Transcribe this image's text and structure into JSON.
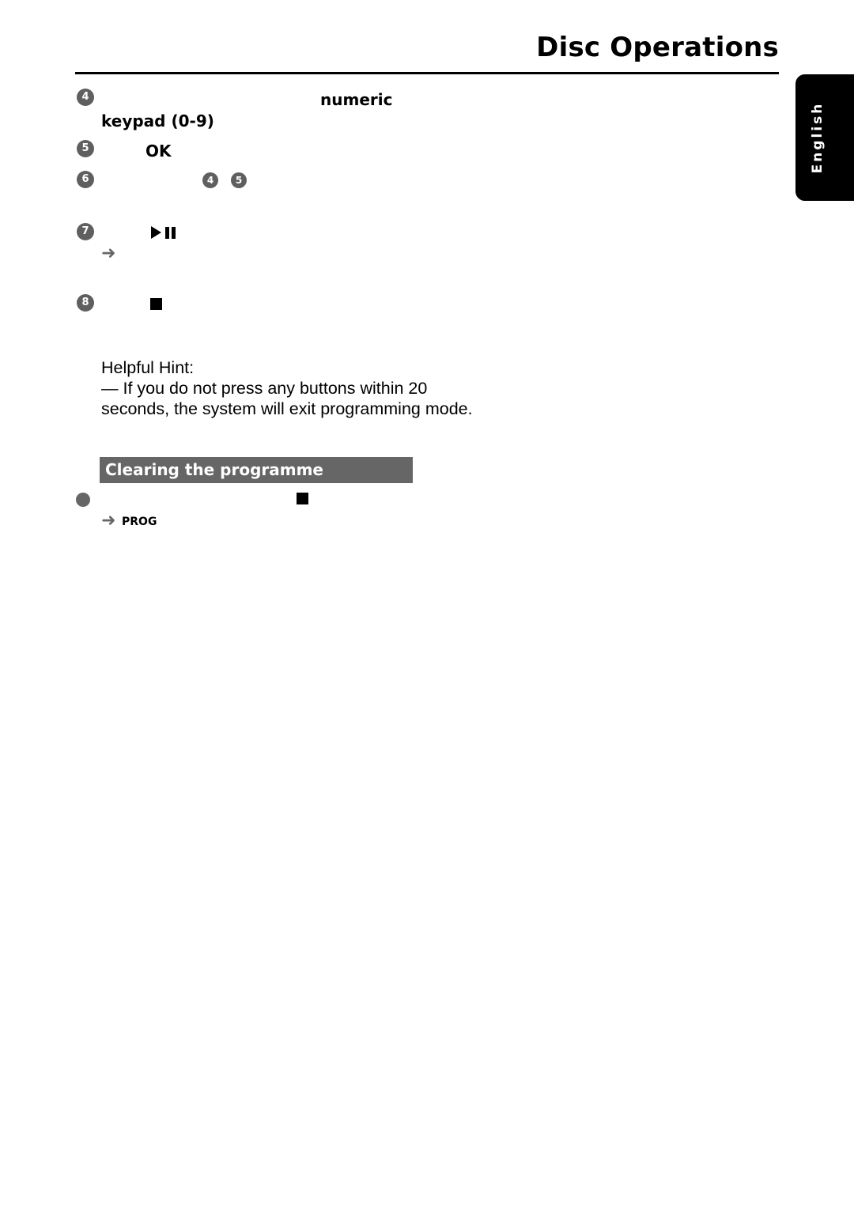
{
  "header": {
    "title": "Disc Operations",
    "language_tab": "English"
  },
  "steps": [
    {
      "number": "4",
      "bold_parts": [
        "numeric",
        "keypad (0-9)"
      ]
    },
    {
      "number": "5",
      "bold_parts": [
        "OK"
      ]
    },
    {
      "number": "6",
      "refs": [
        "4",
        "5"
      ]
    },
    {
      "number": "7",
      "icon": "play-pause-icon",
      "has_arrow": true
    },
    {
      "number": "8",
      "icon": "stop-icon"
    }
  ],
  "hint": {
    "title": "Helpful Hint:",
    "body": "—  If you do not press any buttons within 20 seconds, the system will exit programming mode."
  },
  "clearing_section": {
    "heading": "Clearing the programme",
    "bullet_icon": "stop-icon",
    "result_label": "PROG"
  },
  "colors": {
    "step_circle": "#5f5f5f",
    "section_bar": "#666666",
    "language_tab_bg": "#000000"
  }
}
